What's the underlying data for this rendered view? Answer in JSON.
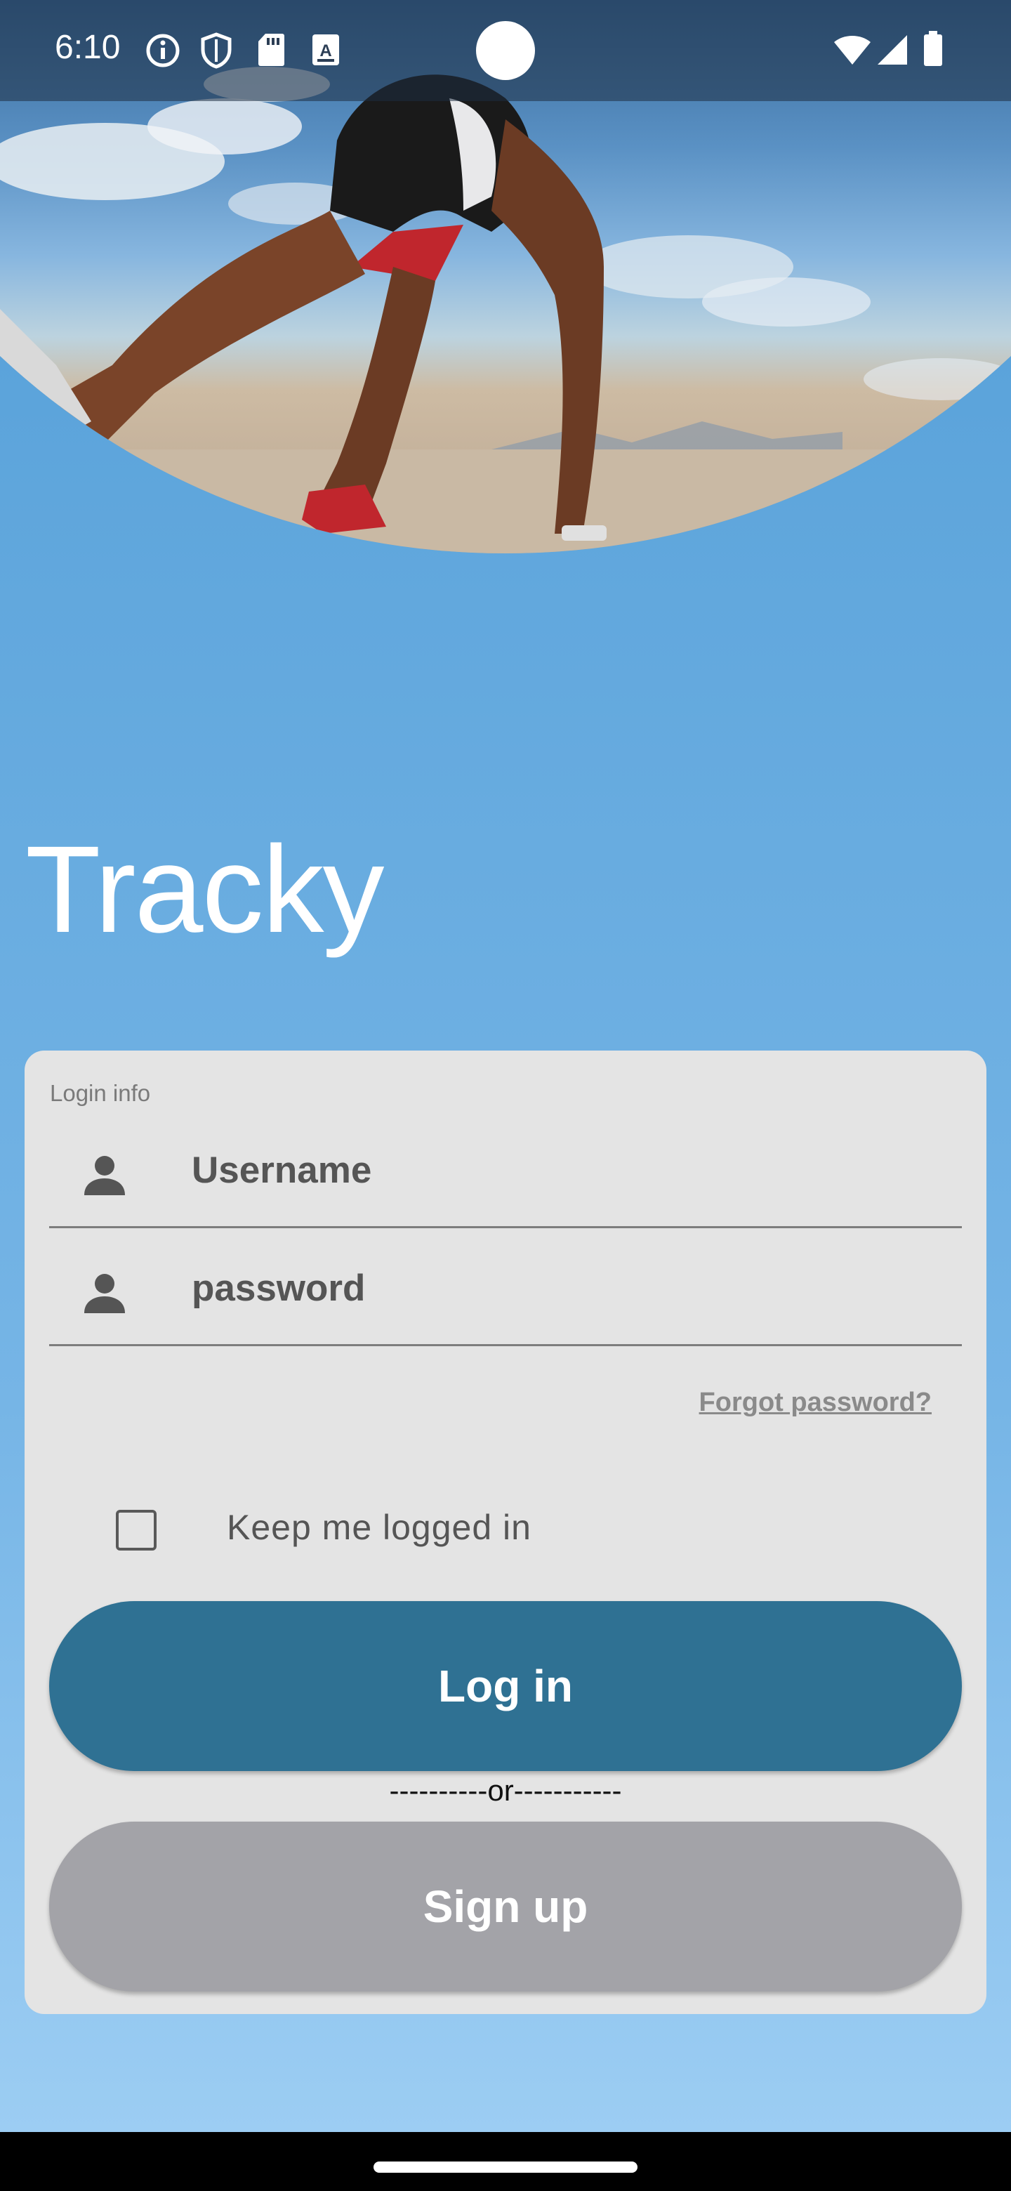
{
  "status_bar": {
    "time": "6:10",
    "left_icons": [
      "info-icon",
      "shield-icon",
      "sd-card-icon",
      "text-a-icon"
    ],
    "right_icons": [
      "wifi-icon",
      "signal-icon",
      "battery-icon"
    ]
  },
  "hero": {
    "image": "runner-starting-position-photo"
  },
  "app": {
    "title": "Tracky"
  },
  "login_card": {
    "section_label": "Login info",
    "username_placeholder": "Username",
    "password_placeholder": "password",
    "forgot_password": "Forgot password?",
    "keep_logged_in": "Keep me logged in",
    "keep_logged_in_checked": false,
    "login_button": "Log in",
    "separator": "----------or-----------",
    "signup_button": "Sign up"
  },
  "colors": {
    "login_button": "#2f7193",
    "signup_button": "#a3a3a8",
    "card_background": "#e4e4e4",
    "background_top": "#4f9bd7",
    "background_bottom": "#9ccdf3"
  }
}
